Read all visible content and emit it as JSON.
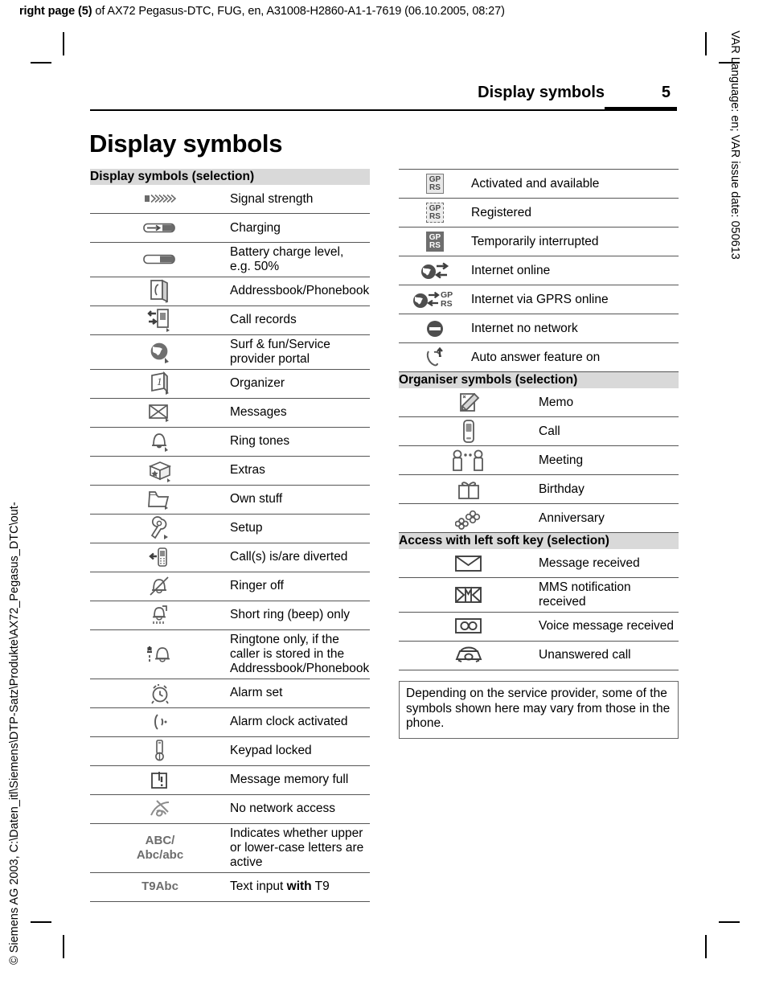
{
  "job_line": {
    "bold_prefix": "right page (5)",
    "rest": " of AX72 Pegasus-DTC, FUG, en, A31008-H2860-A1-1-7619 (06.10.2005, 08:27)"
  },
  "margins": {
    "right_vertical": "VAR Language: en; VAR issue date: 050613",
    "left_vertical": "© Siemens AG 2003, C:\\Daten_itl\\Siemens\\DTP-Satz\\Produkte\\AX72_Pegasus_DTC\\out-"
  },
  "header": {
    "title": "Display symbols",
    "page_number": "5"
  },
  "chapter_title": "Display symbols",
  "left_column": {
    "section_title": "Display symbols (selection)",
    "rows": [
      {
        "icon": "signal-strength-icon",
        "label": "Signal strength"
      },
      {
        "icon": "charging-icon",
        "label": "Charging"
      },
      {
        "icon": "battery-level-icon",
        "label": "Battery charge level, e.g. 50%"
      },
      {
        "icon": "addressbook-icon",
        "label": "Addressbook/Phonebook"
      },
      {
        "icon": "call-records-icon",
        "label": "Call records"
      },
      {
        "icon": "surf-fun-globe-icon",
        "label": "Surf & fun/Service provider portal"
      },
      {
        "icon": "organizer-calendar-icon",
        "label": "Organizer"
      },
      {
        "icon": "messages-envelope-icon",
        "label": "Messages"
      },
      {
        "icon": "ring-tones-bell-icon",
        "label": "Ring tones"
      },
      {
        "icon": "extras-box-icon",
        "label": "Extras"
      },
      {
        "icon": "own-stuff-folder-icon",
        "label": "Own stuff"
      },
      {
        "icon": "setup-wrench-icon",
        "label": "Setup"
      },
      {
        "icon": "call-diverted-icon",
        "label": "Call(s) is/are diverted"
      },
      {
        "icon": "ringer-off-icon",
        "label": "Ringer off"
      },
      {
        "icon": "short-beep-icon",
        "label": "Short ring (beep) only"
      },
      {
        "icon": "ringtone-known-caller-icon",
        "label": "Ringtone only, if the caller is stored in the Addressbook/Phonebook",
        "tall": true
      },
      {
        "icon": "alarm-set-icon",
        "label": "Alarm set"
      },
      {
        "icon": "alarm-clock-activated-icon",
        "label": "Alarm clock activated"
      },
      {
        "icon": "keypad-locked-icon",
        "label": "Keypad locked"
      },
      {
        "icon": "message-memory-full-icon",
        "label": "Message memory full"
      },
      {
        "icon": "no-network-access-icon",
        "label": "No network access"
      },
      {
        "icon": "abc-case-text-icon",
        "icon_text_line1": "ABC/",
        "icon_text_line2": "Abc/abc",
        "label": "Indicates whether upper or lower-case letters are active",
        "tall": true
      },
      {
        "icon": "t9abc-text-icon",
        "icon_text_line1": "T9Abc",
        "label_pre": "Text input ",
        "label_bold": "with",
        "label_post": " T9"
      }
    ]
  },
  "right_column": {
    "gprs_rows": [
      {
        "icon": "gprs-available-icon",
        "icon_text_line1": "GP",
        "icon_text_line2": "RS",
        "label": "Activated and available"
      },
      {
        "icon": "gprs-registered-icon",
        "icon_text_line1": "GP",
        "icon_text_line2": "RS",
        "label": "Registered"
      },
      {
        "icon": "gprs-interrupted-icon",
        "icon_text_line1": "GP",
        "icon_text_line2": "RS",
        "label": "Temporarily interrupted"
      },
      {
        "icon": "internet-online-icon",
        "label": "Internet online"
      },
      {
        "icon": "internet-gprs-online-icon",
        "label": "Internet via GPRS online"
      },
      {
        "icon": "internet-no-network-icon",
        "label": "Internet no network"
      },
      {
        "icon": "auto-answer-icon",
        "label": "Auto answer feature on"
      }
    ],
    "organiser": {
      "section_title": "Organiser symbols (selection)",
      "rows": [
        {
          "icon": "memo-icon",
          "label": "Memo"
        },
        {
          "icon": "call-phone-icon",
          "label": "Call"
        },
        {
          "icon": "meeting-icon",
          "label": "Meeting"
        },
        {
          "icon": "birthday-gift-icon",
          "label": "Birthday"
        },
        {
          "icon": "anniversary-flowers-icon",
          "label": "Anniversary"
        }
      ]
    },
    "softkey": {
      "section_title": "Access with left soft key (selection)",
      "rows": [
        {
          "icon": "message-received-icon",
          "label": "Message received"
        },
        {
          "icon": "mms-notification-icon",
          "label": "MMS notification received"
        },
        {
          "icon": "voice-message-icon",
          "label": "Voice message received"
        },
        {
          "icon": "unanswered-call-icon",
          "label": "Unanswered call"
        }
      ]
    },
    "note": "Depending on the service provider, some of the symbols shown here may vary from those in the phone."
  }
}
